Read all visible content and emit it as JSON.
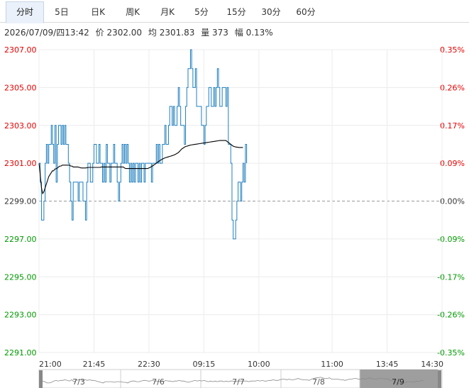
{
  "tabs": [
    {
      "label": "分时",
      "active": true
    },
    {
      "label": "5日",
      "active": false
    },
    {
      "label": "日K",
      "active": false
    },
    {
      "label": "周K",
      "active": false
    },
    {
      "label": "月K",
      "active": false
    },
    {
      "label": "5分",
      "active": false
    },
    {
      "label": "15分",
      "active": false
    },
    {
      "label": "30分",
      "active": false
    },
    {
      "label": "60分",
      "active": false
    }
  ],
  "info": {
    "datetime": "2026/07/09/四13:42",
    "price": "价 2302.00",
    "avg": "均 2301.83",
    "volume": "量 373",
    "change": "幅 0.13%"
  },
  "colors": {
    "up": "#e60000",
    "down": "#009900",
    "price_line": "#1f7fbf",
    "avg_line": "#000000",
    "grid": "#ececec"
  },
  "chart_data": {
    "type": "line",
    "ylim": [
      2291,
      2307
    ],
    "prev_close": 2299,
    "y_ticks_left": [
      "2307.00",
      "2305.00",
      "2303.00",
      "2301.00",
      "2299.00",
      "2297.00",
      "2295.00",
      "2293.00",
      "2291.00"
    ],
    "y_ticks_right": [
      "0.35%",
      "0.26%",
      "0.17%",
      "0.09%",
      "0.00%",
      "-0.09%",
      "-0.17%",
      "-0.26%",
      "-0.35%"
    ],
    "x_ticks": [
      "21:00",
      "21:45",
      "22:30",
      "09:15",
      "10:00",
      "11:00",
      "13:45",
      "14:30"
    ],
    "x_tick_index": [
      0,
      45,
      90,
      135,
      180,
      240,
      285,
      330
    ],
    "n_total": 330,
    "series": [
      {
        "key": "price",
        "values": [
          2301,
          2300,
          2298,
          2298,
          2299,
          2301,
          2302,
          2301,
          2302,
          2302,
          2303,
          2302,
          2301,
          2303,
          2300,
          2302,
          2303,
          2303,
          2302,
          2303,
          2302,
          2303,
          2302,
          2302,
          2301,
          2300,
          2299,
          2298,
          2300,
          2300,
          2300,
          2300,
          2299,
          2300,
          2300,
          2300,
          2299,
          2299,
          2298,
          2300,
          2301,
          2301,
          2300,
          2300,
          2301,
          2302,
          2302,
          2301,
          2301,
          2302,
          2301,
          2301,
          2300,
          2301,
          2300,
          2302,
          2301,
          2301,
          2300,
          2301,
          2301,
          2302,
          2301,
          2301,
          2300,
          2299,
          2300,
          2301,
          2302,
          2301,
          2302,
          2301,
          2302,
          2301,
          2300,
          2301,
          2300,
          2301,
          2300,
          2301,
          2301,
          2300,
          2301,
          2300,
          2301,
          2301,
          2300,
          2301,
          2301,
          2301,
          2301,
          2301,
          2300,
          2301,
          2301,
          2301,
          2302,
          2301,
          2302,
          2301,
          2301,
          2302,
          2302,
          2303,
          2302,
          2302,
          2303,
          2304,
          2304,
          2303,
          2304,
          2303,
          2303,
          2304,
          2305,
          2304,
          2303,
          2303,
          2303,
          2302,
          2304,
          2305,
          2306,
          2306,
          2307,
          2306,
          2305,
          2305,
          2306,
          2304,
          2304,
          2304,
          2304,
          2303,
          2303,
          2302,
          2303,
          2304,
          2304,
          2305,
          2305,
          2304,
          2304,
          2305,
          2304,
          2305,
          2306,
          2305,
          2304,
          2304,
          2305,
          2305,
          2305,
          2304,
          2305,
          2302,
          2302,
          2301,
          2298,
          2297,
          2297,
          2298,
          2299,
          2300,
          2300,
          2299,
          2300,
          2301,
          2300,
          2302,
          2301
        ]
      },
      {
        "key": "avg",
        "values": [
          2301,
          2300.4,
          2299.7,
          2299.4,
          2299.5,
          2299.7,
          2299.9,
          2300.1,
          2300.3,
          2300.4,
          2300.5,
          2300.6,
          2300.6,
          2300.7,
          2300.7,
          2300.75,
          2300.8,
          2300.85,
          2300.85,
          2300.9,
          2300.9,
          2300.9,
          2300.9,
          2300.9,
          2300.9,
          2300.9,
          2300.85,
          2300.85,
          2300.8,
          2300.8,
          2300.8,
          2300.8,
          2300.8,
          2300.78,
          2300.76,
          2300.75,
          2300.75,
          2300.75,
          2300.75,
          2300.76,
          2300.77,
          2300.78,
          2300.78,
          2300.78,
          2300.78,
          2300.78,
          2300.78,
          2300.78,
          2300.78,
          2300.78,
          2300.78,
          2300.8,
          2300.8,
          2300.8,
          2300.8,
          2300.8,
          2300.8,
          2300.8,
          2300.8,
          2300.8,
          2300.8,
          2300.8,
          2300.8,
          2300.8,
          2300.8,
          2300.8,
          2300.8,
          2300.8,
          2300.8,
          2300.8,
          2300.75,
          2300.72,
          2300.72,
          2300.72,
          2300.72,
          2300.72,
          2300.72,
          2300.72,
          2300.72,
          2300.72,
          2300.72,
          2300.72,
          2300.72,
          2300.72,
          2300.72,
          2300.72,
          2300.72,
          2300.72,
          2300.72,
          2300.72,
          2300.75,
          2300.78,
          2300.82,
          2300.86,
          2300.9,
          2300.95,
          2301.0,
          2301.05,
          2301.1,
          2301.14,
          2301.18,
          2301.22,
          2301.25,
          2301.28,
          2301.3,
          2301.32,
          2301.34,
          2301.36,
          2301.38,
          2301.4,
          2301.42,
          2301.45,
          2301.48,
          2301.52,
          2301.56,
          2301.62,
          2301.7,
          2301.76,
          2301.8,
          2301.85,
          2301.88,
          2301.9,
          2301.92,
          2301.94,
          2301.96,
          2301.97,
          2301.98,
          2301.99,
          2302.0,
          2302.01,
          2302.02,
          2302.03,
          2302.04,
          2302.05,
          2302.06,
          2302.07,
          2302.08,
          2302.09,
          2302.1,
          2302.11,
          2302.12,
          2302.13,
          2302.14,
          2302.15,
          2302.16,
          2302.17,
          2302.18,
          2302.19,
          2302.2,
          2302.2,
          2302.2,
          2302.2,
          2302.2,
          2302.2,
          2302.15,
          2302.1,
          2302.05,
          2302.0,
          2301.95,
          2301.9,
          2301.88,
          2301.86,
          2301.85,
          2301.84,
          2301.83,
          2301.83,
          2301.83,
          2301.83
        ]
      }
    ]
  },
  "navigator": {
    "labels": [
      "7/3",
      "7/6",
      "7/7",
      "7/8",
      "7/9"
    ]
  }
}
